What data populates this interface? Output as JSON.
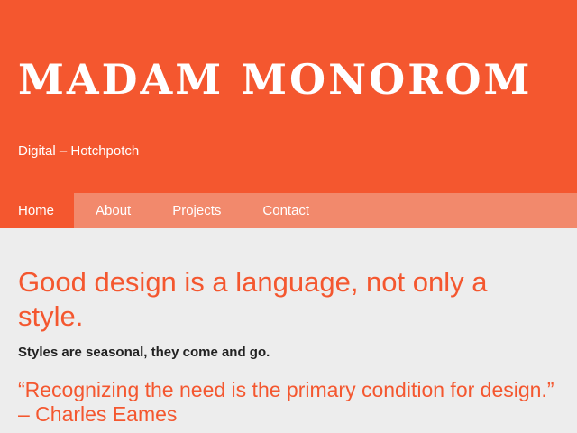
{
  "site": {
    "title": "MADAM MONOROM",
    "tagline": "Digital – Hotchpotch"
  },
  "nav": {
    "items": [
      {
        "label": "Home",
        "active": true
      },
      {
        "label": "About",
        "active": false
      },
      {
        "label": "Projects",
        "active": false
      },
      {
        "label": "Contact",
        "active": false
      }
    ]
  },
  "main": {
    "headline": "Good design is a language, not only a style.",
    "subline": "Styles are seasonal, they come and go.",
    "quote": "“Recognizing the need is the primary condition for design.” – Charles Eames"
  },
  "colors": {
    "brand": "#f4572f",
    "nav_bg": "#f2896c",
    "page_bg": "#ededed",
    "text_dark": "#222222"
  }
}
